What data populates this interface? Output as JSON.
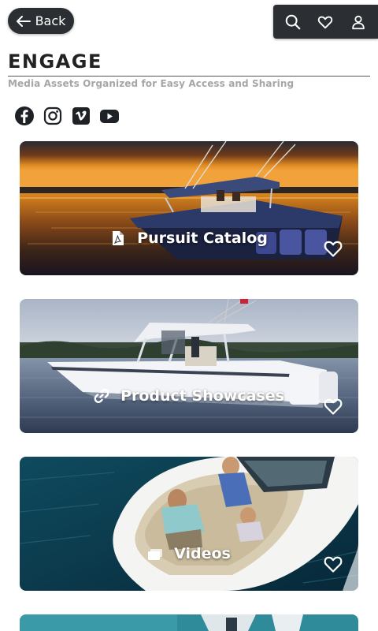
{
  "header": {
    "back_label": "Back",
    "tools": [
      {
        "icon": "search-icon"
      },
      {
        "icon": "heart-icon"
      },
      {
        "icon": "user-icon"
      }
    ]
  },
  "page": {
    "title": "ENGAGE",
    "subtitle": "Media Assets Organized for Easy Access and Sharing"
  },
  "social": [
    {
      "icon": "facebook-icon"
    },
    {
      "icon": "instagram-icon"
    },
    {
      "icon": "vimeo-icon"
    },
    {
      "icon": "youtube-icon"
    }
  ],
  "cards": [
    {
      "label": "Pursuit Catalog",
      "icon": "pdf-icon"
    },
    {
      "label": "Product Showcases",
      "icon": "link-icon"
    },
    {
      "label": "Videos",
      "icon": "folder-icon"
    }
  ],
  "colors": {
    "dark": "#2b2f33",
    "subtitle": "#a6a6a6",
    "white": "#ffffff"
  }
}
